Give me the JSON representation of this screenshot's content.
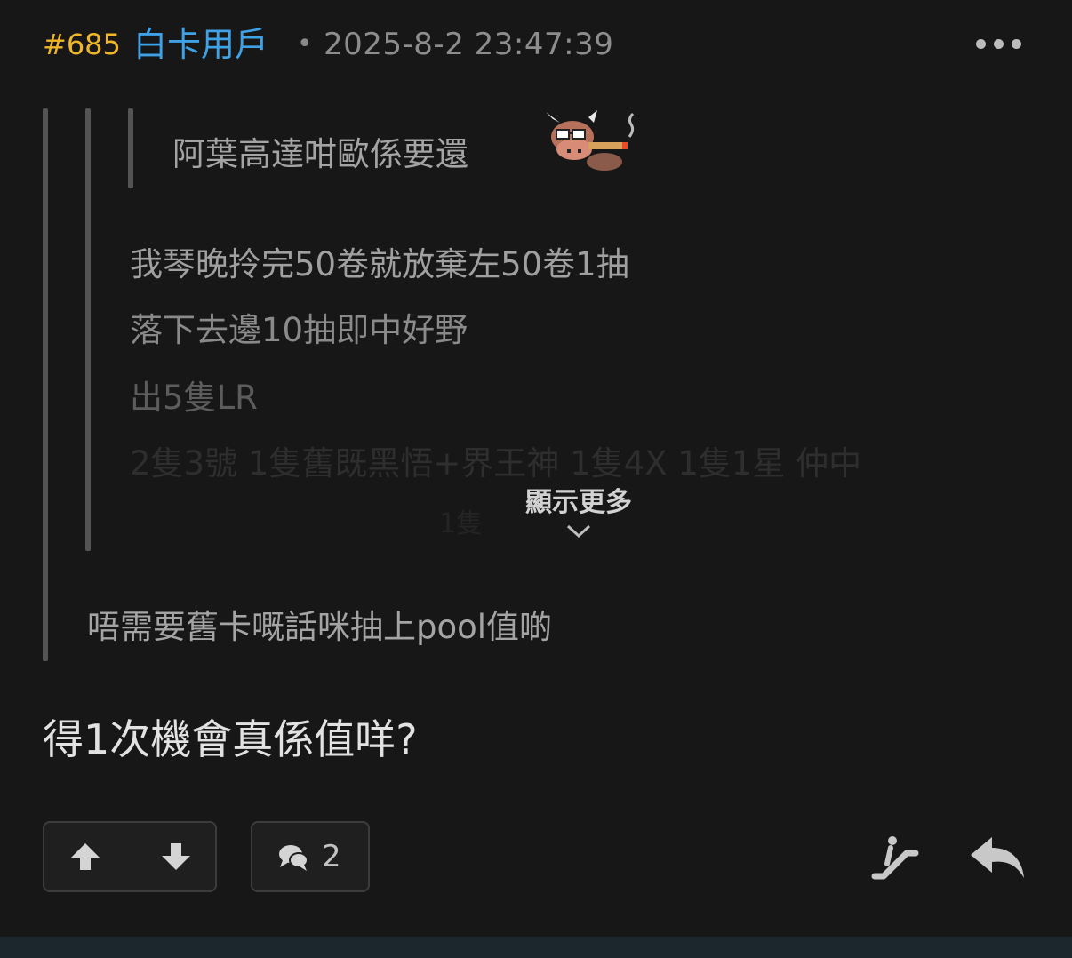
{
  "post": {
    "number": "#685",
    "username": "白卡用戶",
    "separator": "•",
    "timestamp": "2025-8-2 23:47:39",
    "more_icon": "ellipsis-icon"
  },
  "quotes": {
    "level3": {
      "text": "阿葉高達咁歐係要還",
      "emoji": "cow-smoking-cigar-emoji"
    },
    "level2": {
      "lines": [
        "我琴晚拎完50卷就放棄左50卷1抽",
        "落下去邊10抽即中好野",
        "出5隻LR",
        "2隻3號 1隻舊既黑悟+界王神 1隻4X 1隻1星 仲中",
        "1隻"
      ],
      "show_more_label": "顯示更多",
      "show_more_icon": "chevron-down-icon"
    },
    "level1": {
      "text": "唔需要舊卡嘅話咪抽上pool值啲"
    }
  },
  "content": {
    "text": "得1次機會真係值咩?"
  },
  "actions": {
    "upvote_icon": "arrow-up-icon",
    "downvote_icon": "arrow-down-icon",
    "comment_icon": "comments-icon",
    "comment_count": "2",
    "escalator_icon": "escalator-icon",
    "reply_icon": "reply-icon"
  },
  "colors": {
    "background": "#171717",
    "post_number": "#f0b629",
    "username": "#3fa1e6",
    "timestamp": "#8d8d8d",
    "quote_bar": "#545454",
    "content_text": "#e2e2e2"
  }
}
